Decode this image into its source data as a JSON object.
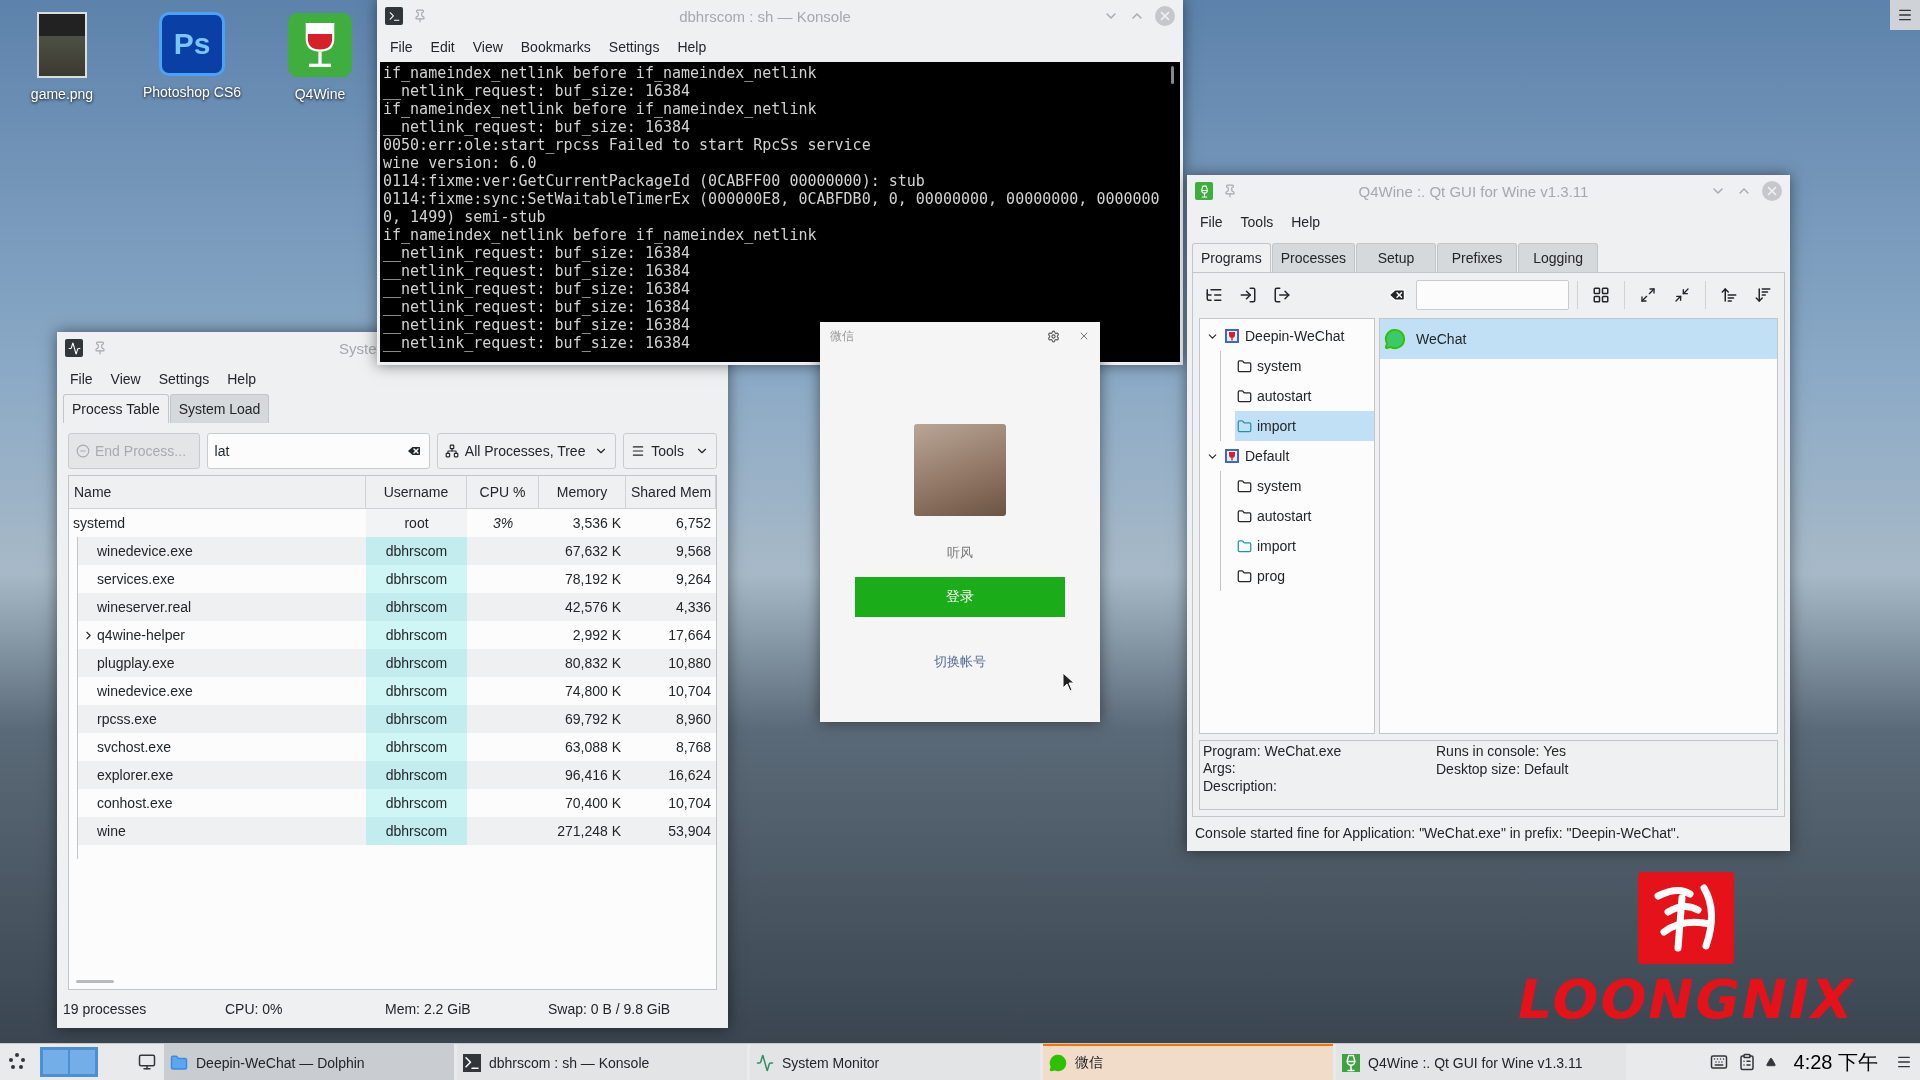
{
  "desktop": {
    "icons": [
      {
        "label": "game.png",
        "kind": "image"
      },
      {
        "label": "Photoshop CS6",
        "kind": "photoshop",
        "glyph": "Ps"
      },
      {
        "label": "Q4Wine",
        "kind": "wine"
      }
    ],
    "logo": {
      "text": "LOONGNIX"
    }
  },
  "system_monitor": {
    "title": "Syste",
    "menu": [
      "File",
      "View",
      "Settings",
      "Help"
    ],
    "tabs": [
      {
        "label": "Process Table",
        "selected": true
      },
      {
        "label": "System Load",
        "selected": false
      }
    ],
    "end_button": {
      "label": "End Process...",
      "disabled": true
    },
    "search": {
      "value": "lat"
    },
    "filter": {
      "value": "All Processes, Tree"
    },
    "tools_button": {
      "label": "Tools"
    },
    "table": {
      "columns": [
        "Name",
        "Username",
        "CPU %",
        "Memory",
        "Shared Mem"
      ],
      "rows": [
        {
          "name": "systemd",
          "username": "root",
          "own": false,
          "cpu": "3%",
          "memory": "3,536 K",
          "shared": "6,752",
          "children": [
            {
              "name": "winedevice.exe",
              "username": "dbhrscom",
              "own": true,
              "memory": "67,632 K",
              "shared": "9,568",
              "expandable": false
            },
            {
              "name": "services.exe",
              "username": "dbhrscom",
              "own": true,
              "memory": "78,192 K",
              "shared": "9,264",
              "expandable": false
            },
            {
              "name": "wineserver.real",
              "username": "dbhrscom",
              "own": true,
              "memory": "42,576 K",
              "shared": "4,336",
              "expandable": false
            },
            {
              "name": "q4wine-helper",
              "username": "dbhrscom",
              "own": true,
              "memory": "2,992 K",
              "shared": "17,664",
              "expandable": true
            },
            {
              "name": "plugplay.exe",
              "username": "dbhrscom",
              "own": true,
              "memory": "80,832 K",
              "shared": "10,880",
              "expandable": false
            },
            {
              "name": "winedevice.exe",
              "username": "dbhrscom",
              "own": true,
              "memory": "74,800 K",
              "shared": "10,704",
              "expandable": false
            },
            {
              "name": "rpcss.exe",
              "username": "dbhrscom",
              "own": true,
              "memory": "69,792 K",
              "shared": "8,960",
              "expandable": false
            },
            {
              "name": "svchost.exe",
              "username": "dbhrscom",
              "own": true,
              "memory": "63,088 K",
              "shared": "8,768",
              "expandable": false
            },
            {
              "name": "explorer.exe",
              "username": "dbhrscom",
              "own": true,
              "memory": "96,416 K",
              "shared": "16,624",
              "expandable": false
            },
            {
              "name": "conhost.exe",
              "username": "dbhrscom",
              "own": true,
              "memory": "70,400 K",
              "shared": "10,704",
              "expandable": false
            },
            {
              "name": "wine",
              "username": "dbhrscom",
              "own": true,
              "memory": "271,248 K",
              "shared": "53,904",
              "expandable": false
            }
          ]
        }
      ]
    },
    "status_bar": [
      "19 processes",
      "CPU: 0%",
      "Mem: 2.2 GiB",
      "Swap: 0 B / 9.8 GiB"
    ]
  },
  "konsole": {
    "title": "dbhrscom : sh — Konsole",
    "menu": [
      "File",
      "Edit",
      "View",
      "Bookmarks",
      "Settings",
      "Help"
    ],
    "lines": [
      "if_nameindex_netlink before if_nameindex_netlink",
      "__netlink_request: buf_size: 16384",
      "if_nameindex_netlink before if_nameindex_netlink",
      "__netlink_request: buf_size: 16384",
      "0050:err:ole:start_rpcss Failed to start RpcSs service",
      "wine version: 6.0",
      "0114:fixme:ver:GetCurrentPackageId (0CABFF00 00000000): stub",
      "0114:fixme:sync:SetWaitableTimerEx (000000E8, 0CABFDB0, 0, 00000000, 00000000, 0000000",
      "0, 1499) semi-stub",
      "if_nameindex_netlink before if_nameindex_netlink",
      "__netlink_request: buf_size: 16384",
      "__netlink_request: buf_size: 16384",
      "__netlink_request: buf_size: 16384",
      "__netlink_request: buf_size: 16384",
      "__netlink_request: buf_size: 16384",
      "__netlink_request: buf_size: 16384"
    ]
  },
  "wechat": {
    "title": "微信",
    "user": "听风",
    "login_button": "登录",
    "switch_link": "切换帐号"
  },
  "q4wine": {
    "title": "Q4Wine :. Qt GUI for Wine v1.3.11",
    "menu": [
      "File",
      "Tools",
      "Help"
    ],
    "tabs": [
      {
        "label": "Programs",
        "selected": true
      },
      {
        "label": "Processes",
        "selected": false
      },
      {
        "label": "Setup",
        "selected": false
      },
      {
        "label": "Prefixes",
        "selected": false
      },
      {
        "label": "Logging",
        "selected": false
      }
    ],
    "tree": [
      {
        "label": "Deepin-WeChat",
        "expanded": true,
        "children": [
          {
            "label": "system",
            "kind": "plain",
            "selected": false
          },
          {
            "label": "autostart",
            "kind": "plain",
            "selected": false
          },
          {
            "label": "import",
            "kind": "import",
            "selected": true
          }
        ]
      },
      {
        "label": "Default",
        "expanded": true,
        "children": [
          {
            "label": "system",
            "kind": "plain",
            "selected": false
          },
          {
            "label": "autostart",
            "kind": "plain",
            "selected": false
          },
          {
            "label": "import",
            "kind": "import",
            "selected": false
          },
          {
            "label": "prog",
            "kind": "plain",
            "selected": false
          }
        ]
      }
    ],
    "programs": [
      {
        "label": "WeChat",
        "selected": true
      }
    ],
    "info_left": [
      "Program: WeChat.exe",
      "Args:",
      "Description:"
    ],
    "info_right": [
      "Runs in console: Yes",
      "Desktop size: Default"
    ],
    "status": "Console started fine for Application: \"WeChat.exe\" in prefix: \"Deepin-WeChat\"."
  },
  "taskbar": {
    "tasks": [
      {
        "label": "Deepin-WeChat — Dolphin",
        "kind": "folder",
        "selected": false,
        "minimized": true
      },
      {
        "label": "dbhrscom : sh — Konsole",
        "kind": "terminal",
        "selected": false,
        "minimized": false
      },
      {
        "label": "System Monitor",
        "kind": "monitor",
        "selected": false,
        "minimized": false
      },
      {
        "label": "微信",
        "kind": "chat",
        "selected": true,
        "minimized": false
      },
      {
        "label": "Q4Wine :. Qt GUI for Wine v1.3.11",
        "kind": "wine",
        "selected": false,
        "minimized": false
      }
    ],
    "clock": "4:28 下午"
  }
}
